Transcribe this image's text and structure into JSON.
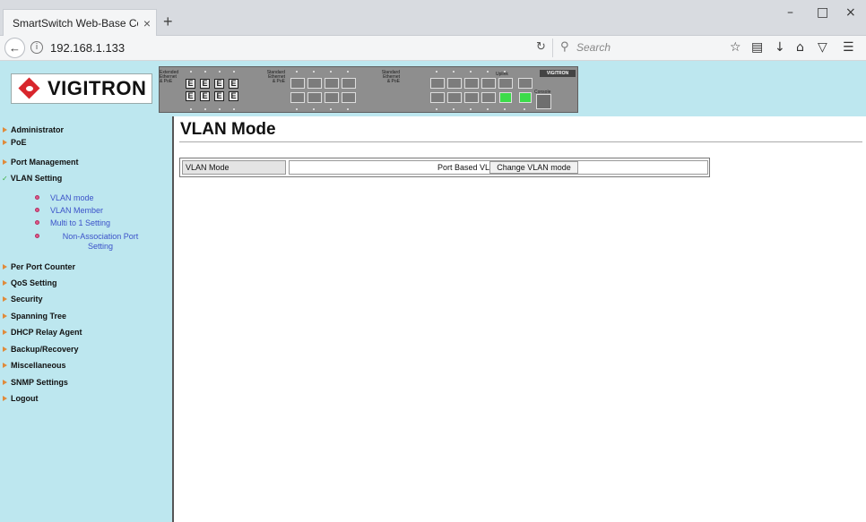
{
  "browser": {
    "tab_title": "SmartSwitch Web-Base Controll",
    "tab_close": "×",
    "new_tab": "+",
    "url": "192.168.1.133",
    "search_placeholder": "Search",
    "window_controls": {
      "minimize": "–",
      "maximize": "□",
      "close": "×"
    }
  },
  "header": {
    "logo_text": "VIGITRON",
    "panel": {
      "label_extended": "Extended\nEthernet\n& PoE",
      "label_standard_poe": "Standard\nEthernet\n& PoE",
      "label_standard_poe_2": "Standard\nEthernet\n& PoE",
      "label_uplink": "Uplink",
      "label_console": "Console",
      "brand": "VIGITRON",
      "extended_port_glyph": "E"
    }
  },
  "sidebar": {
    "items": [
      {
        "label": "Administrator",
        "expanded": false
      },
      {
        "label": "PoE",
        "expanded": false
      },
      {
        "label": "Port Management",
        "expanded": false
      },
      {
        "label": "VLAN Setting",
        "expanded": true
      },
      {
        "label": "Per Port Counter",
        "expanded": false
      },
      {
        "label": "QoS Setting",
        "expanded": false
      },
      {
        "label": "Security",
        "expanded": false
      },
      {
        "label": "Spanning Tree",
        "expanded": false
      },
      {
        "label": "DHCP Relay Agent",
        "expanded": false
      },
      {
        "label": "Backup/Recovery",
        "expanded": false
      },
      {
        "label": "Miscellaneous",
        "expanded": false
      },
      {
        "label": "SNMP Settings",
        "expanded": false
      },
      {
        "label": "Logout",
        "expanded": false
      }
    ],
    "vlan_subitems": [
      {
        "label": "VLAN mode"
      },
      {
        "label": "VLAN Member"
      },
      {
        "label": "Multi to 1 Setting"
      },
      {
        "label": "Non-Association Port Setting"
      }
    ]
  },
  "main": {
    "title": "VLAN Mode",
    "vlan_mode_label": "VLAN Mode",
    "vlan_mode_value": "Port Based VLAN",
    "change_button_label": "Change VLAN mode"
  },
  "colors": {
    "header_bg": "#bde7ef",
    "sidebar_bg": "#bde7ef",
    "logo_red": "#d8262c",
    "link_blue": "#3b52c9",
    "menu_arrow": "#e08a3a",
    "uplink_green": "#3cdc4a"
  }
}
